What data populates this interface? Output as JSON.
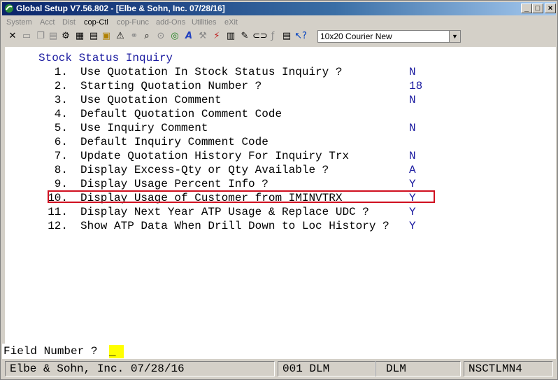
{
  "window": {
    "title": "Global Setup V7.56.802 - [Elbe & Sohn, Inc. 07/28/16]",
    "minimize": "_",
    "maximize": "□",
    "close": "×"
  },
  "menu": {
    "items": [
      "System",
      "Acct",
      "Dist",
      "cop-Ctl",
      "cop-Func",
      "add-Ons",
      "Utilities",
      "eXit"
    ]
  },
  "toolbar": {
    "font_select": "10x20 Courier New",
    "font_select_arrow": "▼"
  },
  "screen": {
    "title": "Stock Status Inquiry",
    "rows": [
      {
        "num": "1.",
        "label": "Use Quotation In Stock Status Inquiry ?",
        "value": "N"
      },
      {
        "num": "2.",
        "label": "Starting Quotation Number ?",
        "value": "18"
      },
      {
        "num": "3.",
        "label": "Use Quotation Comment",
        "value": "N"
      },
      {
        "num": "4.",
        "label": "Default Quotation Comment Code",
        "value": ""
      },
      {
        "num": "5.",
        "label": "Use Inquiry Comment",
        "value": "N"
      },
      {
        "num": "6.",
        "label": "Default Inquiry Comment Code",
        "value": ""
      },
      {
        "num": "7.",
        "label": "Update Quotation History For Inquiry Trx",
        "value": "N"
      },
      {
        "num": "8.",
        "label": "Display Excess-Qty or Qty Available ?",
        "value": "A"
      },
      {
        "num": "9.",
        "label": "Display Usage Percent Info ?",
        "value": "Y"
      },
      {
        "num": "10.",
        "label": "Display Usage of Customer from IMINVTRX",
        "value": "Y"
      },
      {
        "num": "11.",
        "label": "Display Next Year ATP Usage & Replace UDC ?",
        "value": "Y"
      },
      {
        "num": "12.",
        "label": "Show ATP Data When Drill Down to Loc History ?",
        "value": "Y"
      }
    ]
  },
  "prompt": {
    "label": "Field Number ?",
    "value": "_"
  },
  "status": {
    "company": "Elbe & Sohn, Inc. 07/28/16",
    "user": "001 DLM",
    "user2": "DLM",
    "program": "NSCTLMN4"
  },
  "colors": {
    "title_blue": "#0a246a",
    "value_blue": "#1a1aa0",
    "highlight_red": "#d01020",
    "input_yellow": "#ffff00"
  }
}
